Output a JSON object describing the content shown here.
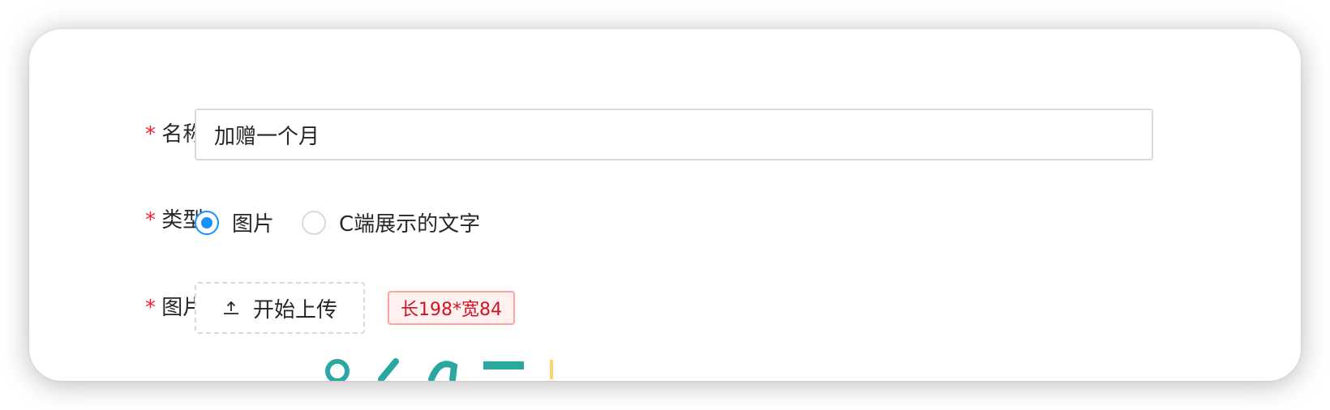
{
  "form": {
    "name": {
      "required_mark": "*",
      "label": "名称:",
      "value": "加赠一个月"
    },
    "type": {
      "required_mark": "*",
      "label": "类型:",
      "options": [
        {
          "label": "图片",
          "checked": true
        },
        {
          "label": "C端展示的文字",
          "checked": false
        }
      ]
    },
    "image": {
      "required_mark": "*",
      "label": "图片:",
      "upload_label": "开始上传",
      "size_hint": "长198*宽84"
    }
  },
  "colors": {
    "primary": "#1890ff",
    "required": "#f5222d",
    "tag_text": "#cf1322",
    "tag_border": "#ffa39e",
    "tag_bg": "#fff1f0",
    "preview_teal": "#2aa8a0",
    "preview_yellow": "#f7d774"
  }
}
